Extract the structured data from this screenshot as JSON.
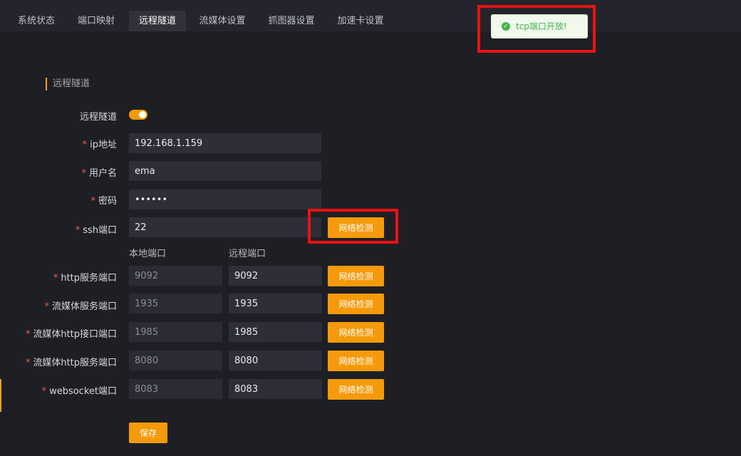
{
  "tabs": [
    {
      "label": "系统状态"
    },
    {
      "label": "端口映射"
    },
    {
      "label": "远程隧道"
    },
    {
      "label": "流媒体设置"
    },
    {
      "label": "抓图器设置"
    },
    {
      "label": "加速卡设置"
    }
  ],
  "section_title": "远程隧道",
  "tunnel": {
    "label": "远程隧道",
    "enabled": true
  },
  "fields": {
    "ip": {
      "label": "ip地址",
      "value": "192.168.1.159"
    },
    "username": {
      "label": "用户名",
      "value": "ema"
    },
    "password": {
      "label": "密码",
      "value": "••••••"
    },
    "ssh_port": {
      "label": "ssh端口",
      "value": "22",
      "button": "网络检测"
    }
  },
  "columns": {
    "local": "本地端口",
    "remote": "远程端口"
  },
  "ports": [
    {
      "label": "http服务端口",
      "local": "9092",
      "remote": "9092",
      "button": "网络检测"
    },
    {
      "label": "流媒体服务端口",
      "local": "1935",
      "remote": "1935",
      "button": "网络检测"
    },
    {
      "label": "流媒体http接口端口",
      "local": "1985",
      "remote": "1985",
      "button": "网络检测"
    },
    {
      "label": "流媒体http服务端口",
      "local": "8080",
      "remote": "8080",
      "button": "网络检测"
    },
    {
      "label": "websocket端口",
      "local": "8083",
      "remote": "8083",
      "button": "网络检测"
    }
  ],
  "required_mark": "*",
  "save_label": "保存",
  "toast": {
    "icon": "check-circle-icon",
    "text": "tcp端口开放!"
  },
  "colors": {
    "accent": "#f59a0a",
    "background": "#1e1f25",
    "success": "#47b34e",
    "highlight": "#ee1111"
  }
}
